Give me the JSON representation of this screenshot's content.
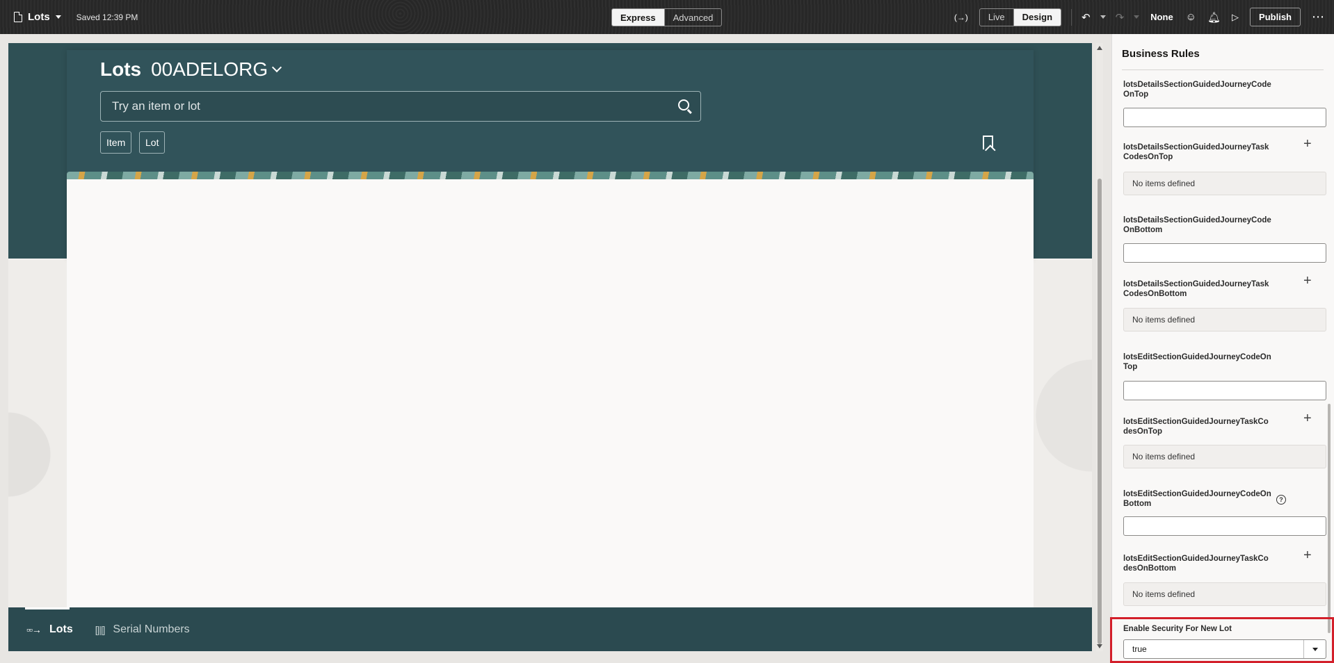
{
  "toolbar": {
    "page_name": "Lots",
    "saved_status": "Saved 12:39 PM",
    "mode_express": "Express",
    "mode_advanced": "Advanced",
    "view_live": "Live",
    "view_design": "Design",
    "variable_icon": "(→)",
    "none_label": "None",
    "publish_label": "Publish",
    "more_icon": "⋯"
  },
  "canvas": {
    "title_main": "Lots",
    "title_org": "00ADELORG",
    "search_placeholder": "Try an item or lot",
    "chip_item": "Item",
    "chip_lot": "Lot",
    "nav_lots": "Lots",
    "nav_serial": "Serial Numbers"
  },
  "panel": {
    "title": "Business Rules",
    "props": [
      {
        "label": "lotsDetailsSectionGuidedJourneyCodeOnTop"
      },
      {
        "label": "lotsDetailsSectionGuidedJourneyTaskCodesOnTop",
        "empty": "No items defined"
      },
      {
        "label": "lotsDetailsSectionGuidedJourneyCodeOnBottom"
      },
      {
        "label": "lotsDetailsSectionGuidedJourneyTaskCodesOnBottom",
        "empty": "No items defined"
      },
      {
        "label": "lotsEditSectionGuidedJourneyCodeOnTop"
      },
      {
        "label": "lotsEditSectionGuidedJourneyTaskCodesOnTop",
        "empty": "No items defined"
      },
      {
        "label": "lotsEditSectionGuidedJourneyCodeOnBottom"
      },
      {
        "label": "lotsEditSectionGuidedJourneyTaskCodesOnBottom",
        "empty": "No items defined"
      }
    ],
    "security_label": "Enable Security For New Lot",
    "security_value": "true"
  },
  "colors": {
    "header_band": "#2f5055",
    "bottom_nav": "#2b4a50",
    "highlight": "#d31f2a"
  }
}
